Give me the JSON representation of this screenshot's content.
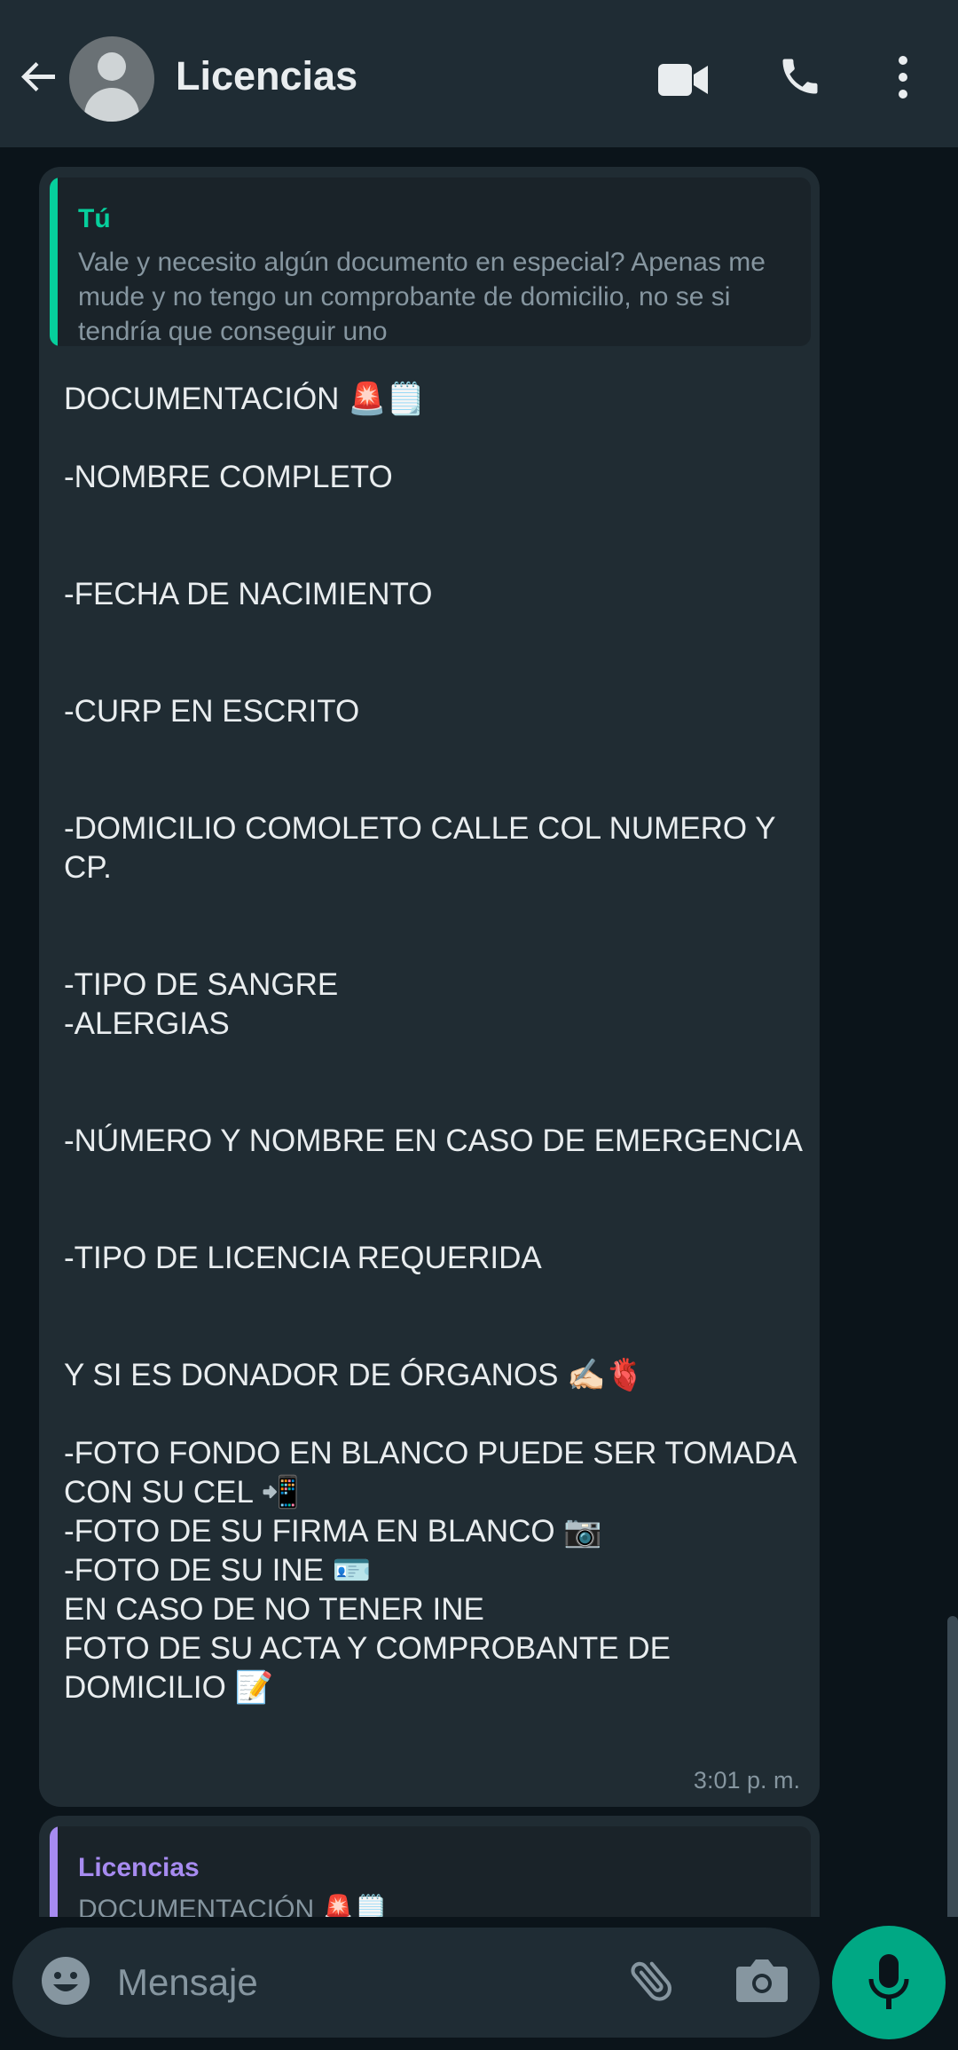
{
  "header": {
    "title": "Licencias"
  },
  "messages": [
    {
      "quote_author": "Tú",
      "quote_text": "Vale y necesito algún documento en especial? Apenas me mude y no tengo un comprobante de domicilio, no se si tendría que conseguir uno",
      "body": "DOCUMENTACIÓN 🚨🗒️\n\n-NOMBRE COMPLETO\n\n\n-FECHA DE NACIMIENTO\n\n\n-CURP EN ESCRITO\n\n\n-DOMICILIO COMOLETO CALLE COL NUMERO Y CP.\n\n\n-TIPO DE SANGRE\n-ALERGIAS\n\n\n-NÚMERO Y NOMBRE EN CASO DE EMERGENCIA\n\n\n-TIPO DE LICENCIA REQUERIDA\n\n\nY SI ES DONADOR DE ÓRGANOS ✍🏻🫀\n\n-FOTO FONDO EN BLANCO PUEDE SER TOMADA CON SU CEL 📲\n-FOTO DE SU FIRMA EN BLANCO 📷\n-FOTO DE SU INE 🪪\nEN CASO DE NO TENER INE\nFOTO DE SU ACTA Y COMPROBANTE DE DOMICILIO 📝",
      "time": "3:01 p. m."
    },
    {
      "quote_author": "Licencias",
      "quote_text": "DOCUMENTACIÓN 🚨🗒️"
    }
  ],
  "input": {
    "placeholder": "Mensaje"
  },
  "colors": {
    "header_bg": "#1f2c34",
    "chat_bg": "#0b141a",
    "bubble_bg": "#202c33",
    "accent": "#00a884",
    "quote_self": "#06cf9c",
    "quote_contact": "#a78bf0"
  },
  "icons": [
    "back-arrow-icon",
    "avatar-icon",
    "video-call-icon",
    "phone-icon",
    "more-vert-icon",
    "emoji-icon",
    "attach-icon",
    "camera-icon",
    "mic-icon"
  ]
}
